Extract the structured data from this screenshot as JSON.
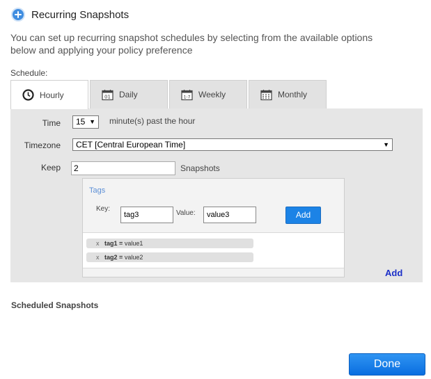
{
  "header": {
    "title": "Recurring Snapshots",
    "icon": "plus-circle-icon"
  },
  "description": "You can set up recurring snapshot schedules by selecting from the available options below and applying your policy preference",
  "schedule_label": "Schedule:",
  "tabs": [
    {
      "label": "Hourly",
      "icon": "clock-icon",
      "active": true
    },
    {
      "label": "Daily",
      "icon": "calendar-01-icon",
      "active": false
    },
    {
      "label": "Weekly",
      "icon": "calendar-1-7-icon",
      "active": false
    },
    {
      "label": "Monthly",
      "icon": "calendar-grid-icon",
      "active": false
    }
  ],
  "form": {
    "time_label": "Time",
    "time_value": "15",
    "time_suffix": "minute(s) past the hour",
    "timezone_label": "Timezone",
    "timezone_value": "CET [Central European Time]",
    "keep_label": "Keep",
    "keep_value": "2",
    "keep_suffix": "Snapshots"
  },
  "tags": {
    "title": "Tags",
    "key_label": "Key:",
    "key_value": "tag3",
    "value_label": "Value:",
    "value_value": "value3",
    "add_button": "Add",
    "items": [
      {
        "remove": "x",
        "key": "tag1",
        "eq": "=",
        "value": "value1"
      },
      {
        "remove": "x",
        "key": "tag2",
        "eq": "=",
        "value": "value2"
      }
    ]
  },
  "add_link": "Add",
  "scheduled_title": "Scheduled Snapshots",
  "done_button": "Done",
  "colors": {
    "accent": "#1c83e6",
    "link": "#1b2fc8",
    "panel": "#e6e6e6"
  }
}
